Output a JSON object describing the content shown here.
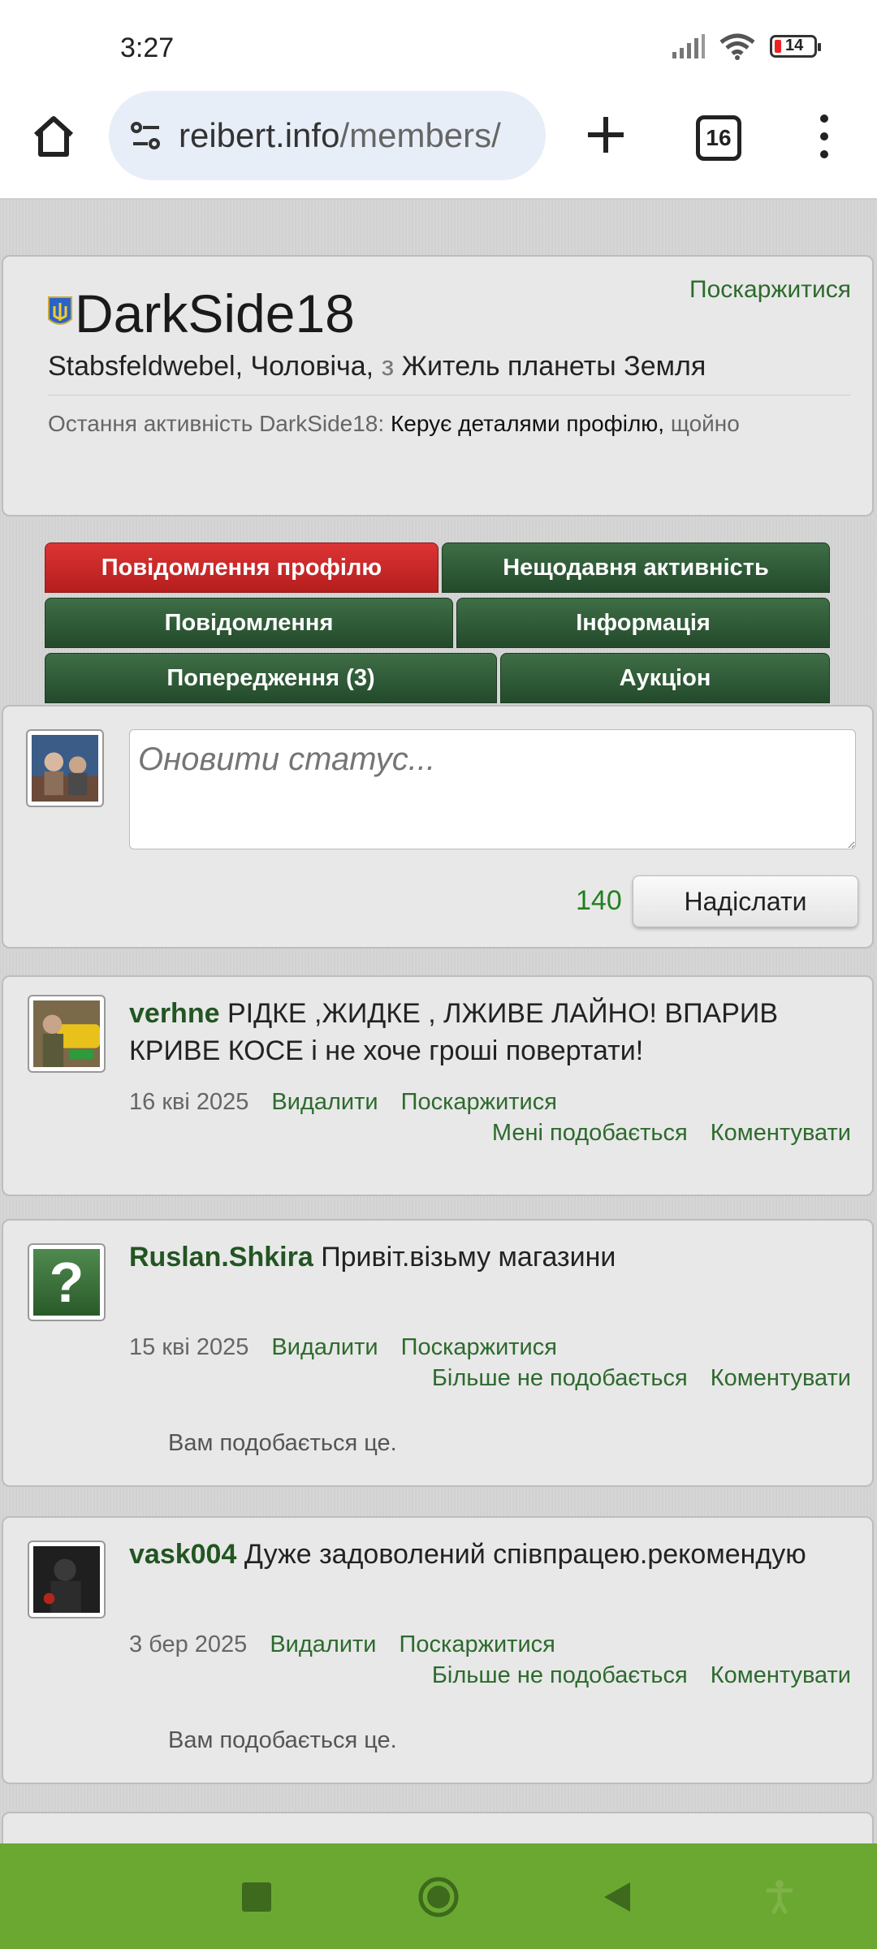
{
  "status_bar": {
    "time": "3:27",
    "battery": "14"
  },
  "browser": {
    "url_main": "reibert.info",
    "url_dim": "/members/",
    "tab_count": "16"
  },
  "profile": {
    "username": "DarkSide18",
    "report_label": "Поскаржитися",
    "rank": "Stabsfeldwebel, Чоловіча,",
    "from_word": "з",
    "location": "Житель планеты Земля",
    "activity_label": "Остання активність DarkSide18:",
    "activity_text": "Керує деталями профілю,",
    "activity_time": "щойно"
  },
  "tabs": [
    {
      "label": "Повідомлення профілю",
      "active": true
    },
    {
      "label": "Нещодавня активність"
    },
    {
      "label": "Повідомлення"
    },
    {
      "label": "Інформація"
    },
    {
      "label": "Попередження (3)"
    },
    {
      "label": "Аукціон"
    }
  ],
  "composer": {
    "placeholder": "Оновити статус...",
    "counter": "140",
    "submit_label": "Надіслати"
  },
  "posts": [
    {
      "author": "verhne",
      "text": "РІДКЕ ,ЖИДКЕ , ЛЖИВЕ ЛАЙНО! ВПАРИВ КРИВЕ КОСЕ і не хоче гроші повертати!",
      "date": "16 кві 2025",
      "delete": "Видалити",
      "report": "Поскаржитися",
      "like": "Мені подобається",
      "comment": "Коментувати"
    },
    {
      "author": "Ruslan.Shkira",
      "text": "Привіт.візьму магазини",
      "date": "15 кві 2025",
      "delete": "Видалити",
      "report": "Поскаржитися",
      "like": "Більше не подобається",
      "comment": "Коментувати",
      "liked_note": "Вам подобається це."
    },
    {
      "author": "vask004",
      "text": "Дуже задоволений співпрацею.рекомендую",
      "date": "3 бер 2025",
      "delete": "Видалити",
      "report": "Поскаржитися",
      "like": "Більше не подобається",
      "comment": "Коментувати",
      "liked_note": "Вам подобається це."
    }
  ],
  "colors": {
    "tab_green": "#2f5c37",
    "tab_red": "#c92828",
    "link_green": "#2d6a2d",
    "nav_green": "#6aa832"
  }
}
